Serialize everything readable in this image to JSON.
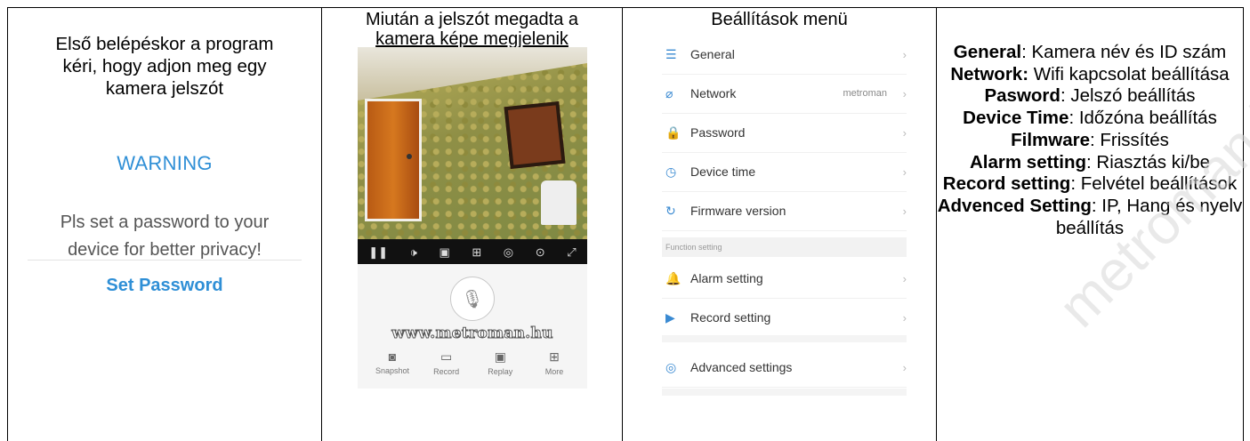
{
  "col1": {
    "intro_lines": [
      "Első belépéskor a program",
      "kéri, hogy adjon meg egy",
      "kamera jelszót"
    ],
    "warning_title": "WARNING",
    "warning_lines": [
      "Pls set a password to your",
      "device for better privacy!"
    ],
    "set_password": "Set Password"
  },
  "col2": {
    "heading_line1": "Miután a jelszót megadta a",
    "heading_line2": "kamera képe megjelenik",
    "watermark": "www.metroman.hu",
    "nav": [
      {
        "label": "Snapshot",
        "icon": "camera-icon"
      },
      {
        "label": "Record",
        "icon": "record-icon"
      },
      {
        "label": "Replay",
        "icon": "replay-icon"
      },
      {
        "label": "More",
        "icon": "more-icon"
      }
    ]
  },
  "col3": {
    "heading": "Beállítások menü",
    "rows": [
      {
        "label": "General",
        "value": "",
        "icon": "general-icon"
      },
      {
        "label": "Network",
        "value": "metroman",
        "icon": "network-icon"
      },
      {
        "label": "Password",
        "value": "",
        "icon": "lock-icon"
      },
      {
        "label": "Device time",
        "value": "",
        "icon": "clock-icon"
      },
      {
        "label": "Firmware version",
        "value": "",
        "icon": "refresh-icon"
      }
    ],
    "section_label": "Function setting",
    "rows2": [
      {
        "label": "Alarm setting",
        "icon": "bell-icon"
      },
      {
        "label": "Record setting",
        "icon": "play-icon"
      },
      {
        "label": "Advanced settings",
        "icon": "settings-icon"
      }
    ]
  },
  "col4": {
    "items": [
      {
        "key": "General",
        "text": ": Kamera név és ID szám"
      },
      {
        "key": "Network:",
        "text": " Wifi kapcsolat beállítása"
      },
      {
        "key": "Pasword",
        "text": ": Jelszó beállítás"
      },
      {
        "key": "Device Time",
        "text": ": Időzóna beállítás"
      },
      {
        "key": "Filmware",
        "text": ": Frissítés"
      },
      {
        "key": "Alarm setting",
        "text": ": Riasztás ki/be"
      },
      {
        "key": "Record setting",
        "text": ": Felvétel beállítások"
      },
      {
        "key": "Advenced Setting",
        "text": ": IP, Hang és nyelv beállítás"
      }
    ]
  },
  "bg_watermark": "metroman.hu"
}
